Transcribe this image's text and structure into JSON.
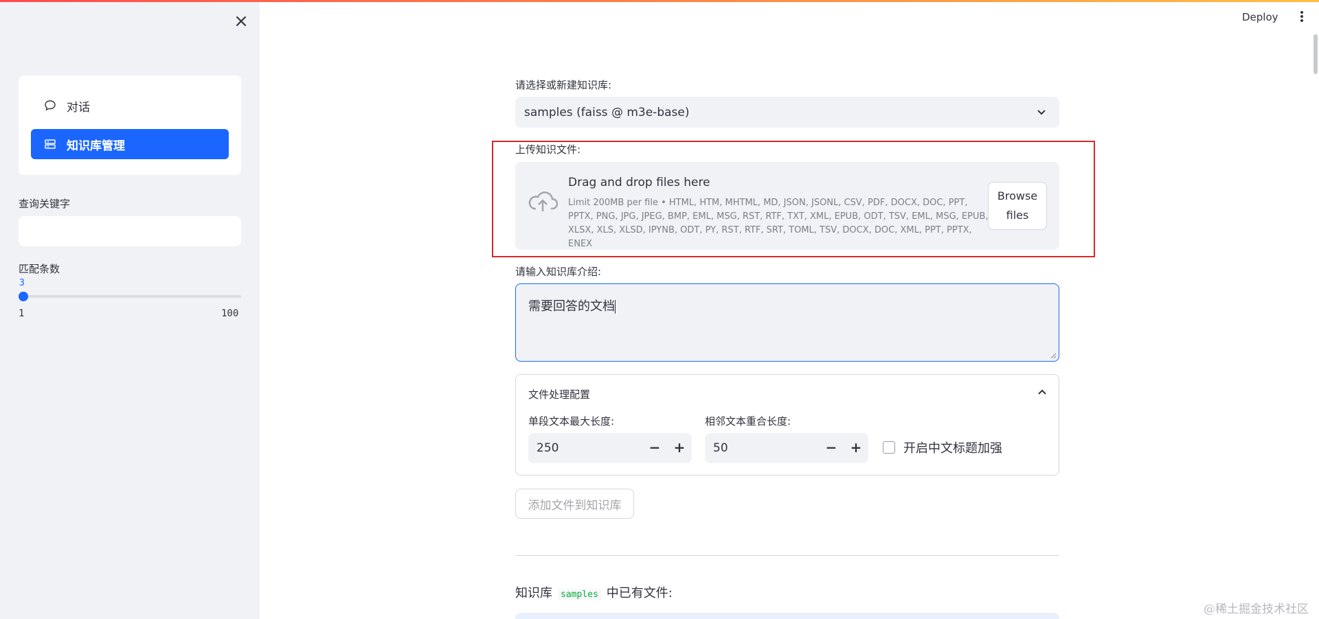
{
  "header": {
    "deploy_label": "Deploy",
    "menu_icon": "kebab-vertical-icon"
  },
  "sidebar": {
    "close_icon": "close-icon",
    "menu": [
      {
        "label": "对话",
        "icon": "chat-bubble-icon",
        "active": false
      },
      {
        "label": "知识库管理",
        "icon": "database-icon",
        "active": true
      }
    ],
    "search_label": "查询关键字",
    "search_value": "",
    "match_label": "匹配条数",
    "slider": {
      "value": "3",
      "min": "1",
      "max": "100"
    }
  },
  "main": {
    "kb_select_label": "请选择或新建知识库:",
    "kb_selected": "samples (faiss @ m3e-base)",
    "upload_label": "上传知识文件:",
    "dropzone": {
      "title": "Drag and drop files here",
      "limit": "Limit 200MB per file • HTML, HTM, MHTML, MD, JSON, JSONL, CSV, PDF, DOCX, DOC, PPT, PPTX, PNG, JPG, JPEG, BMP, EML, MSG, RST, RTF, TXT, XML, EPUB, ODT, TSV, EML, MSG, EPUB, XLSX, XLS, XLSD, IPYNB, ODT, PY, RST, RTF, SRT, TOML, TSV, DOCX, DOC, XML, PPT, PPTX, ENEX",
      "browse_line1": "Browse",
      "browse_line2": "files"
    },
    "intro_label": "请输入知识库介绍:",
    "intro_value": "需要回答的文档",
    "expander": {
      "title": "文件处理配置",
      "chunk_label": "单段文本最大长度:",
      "chunk_value": "250",
      "overlap_label": "相邻文本重合长度:",
      "overlap_value": "50",
      "checkbox_label": "开启中文标题加强",
      "minus": "−",
      "plus": "+"
    },
    "add_button": "添加文件到知识库",
    "files_heading_prefix": "知识库",
    "files_heading_code": "samples",
    "files_heading_suffix": "中已有文件:"
  },
  "watermark": "@稀土掘金技术社区",
  "colors": {
    "accent": "#1a66ff",
    "highlight": "#d9262a",
    "sidebar_bg": "#f0f2f6"
  }
}
